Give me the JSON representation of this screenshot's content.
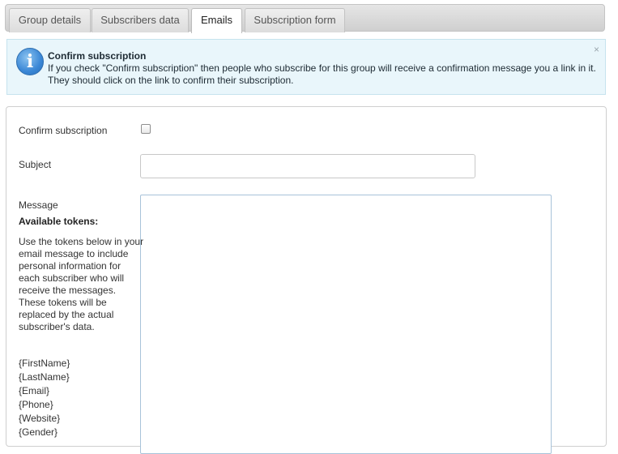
{
  "tabs": [
    {
      "label": "Group details",
      "active": false
    },
    {
      "label": "Subscribers data",
      "active": false
    },
    {
      "label": "Emails",
      "active": true
    },
    {
      "label": "Subscription form",
      "active": false
    }
  ],
  "alert": {
    "icon": "info-icon",
    "title": "Confirm subscription",
    "text": "If you check \"Confirm subscription\" then people who subscribe for this group will receive a confirmation message you a link in it. They should click on the link to confirm their subscription.",
    "close": "×"
  },
  "form": {
    "confirm_label": "Confirm subscription",
    "confirm_checked": false,
    "subject_label": "Subject",
    "subject_value": "",
    "message_label": "Message",
    "message_value": "",
    "tokens_title": "Available tokens:",
    "tokens_desc": "Use the tokens below in your email message to include personal information for each subscriber who will receive the messages. These tokens will be replaced by the actual subscriber's data.",
    "tokens": [
      "{FirstName}",
      "{LastName}",
      "{Email}",
      "{Phone}",
      "{Website}",
      "{Gender}"
    ]
  },
  "colors": {
    "alert_bg": "#e9f6fb",
    "alert_border": "#c6e3ee",
    "info_icon": "#3a87d6"
  }
}
